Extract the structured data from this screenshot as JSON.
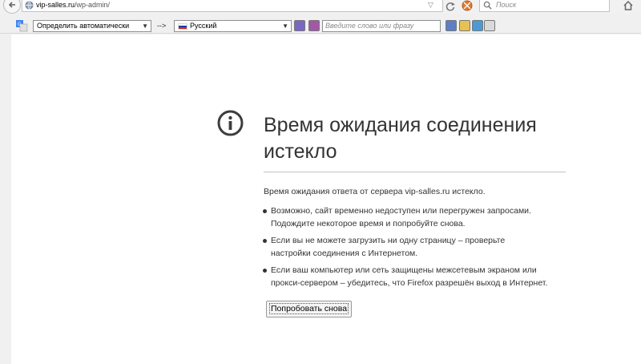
{
  "navbar": {
    "url_host": "vip-salles.ru",
    "url_path": "/wp-admin/",
    "search_placeholder": "Поиск"
  },
  "translate_toolbar": {
    "source_language": "Определить автоматически",
    "arrow": "-->",
    "target_language": "Русский",
    "phrase_placeholder": "Введите слово или фразу"
  },
  "error_page": {
    "title": "Время ожидания соединения истекло",
    "description": "Время ожидания ответа от сервера vip-salles.ru истекло.",
    "bullets": [
      "Возможно, сайт временно недоступен или перегружен запросами.\nПодождите некоторое время и попробуйте снова.",
      "Если вы не можете загрузить ни одну страницу – проверьте\nнастройки соединения с Интернетом.",
      "Если ваш компьютер или сеть защищены межсетевым экраном или\nпрокси-сервером – убедитесь, что Firefox разрешён выход в Интернет."
    ],
    "retry_label": "Попробовать снова"
  },
  "colors": {
    "page_background": "#ffffff",
    "chrome_background": "#f0f0f0",
    "text": "#333333"
  }
}
